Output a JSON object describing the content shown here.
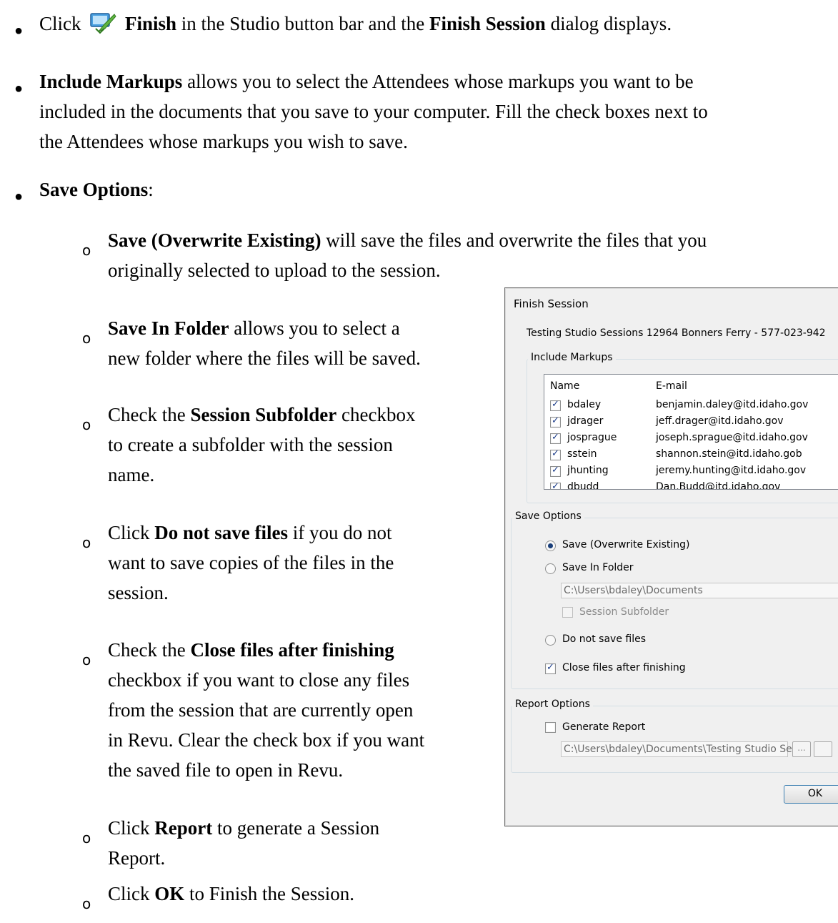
{
  "bullets": {
    "b1": {
      "pre": "Click",
      "strong": "Finish",
      "mid": "in the Studio button bar and the",
      "strong2": "Finish Session",
      "post": "dialog displays."
    },
    "b2": {
      "strong": "Include Markups",
      "line1_rest": "allows you to select the Attendees whose markups you want to be",
      "line2": "included in the documents that you save to your computer. Fill the check boxes next to",
      "line3": "the Attendees whose markups you wish to save."
    },
    "b3": {
      "strong": "Save Options",
      "post": ":"
    }
  },
  "sub_items": {
    "s1": {
      "strong": "Save (Overwrite Existing)",
      "line1_rest": "will save the files and overwrite the files that you",
      "line2": "originally selected to upload to the session."
    },
    "s2": {
      "strong": "Save In Folder",
      "line1_rest": "allows you to select a",
      "line2": "new folder where the files will be saved."
    },
    "s3": {
      "pre": "Check the",
      "strong": "Session Subfolder",
      "line1_rest": "checkbox",
      "line2": "to create a subfolder with the session",
      "line3": "name."
    },
    "s4": {
      "pre": "Click",
      "strong": "Do not save files",
      "line1_rest": "if you do not",
      "line2": "want to save copies of the files in the",
      "line3": "session."
    },
    "s5": {
      "pre": "Check the",
      "strong": "Close files after finishing",
      "line2": "checkbox if you want to close any files",
      "line3": "from the session that are currently open",
      "line4": "in Revu. Clear the check box if you want",
      "line5": "the saved file to open in Revu."
    },
    "s6": {
      "pre": "Click",
      "strong": "Report",
      "line1_rest": "to generate a Session",
      "line2": "Report."
    },
    "s7": {
      "pre": "Click",
      "strong": "OK",
      "line1_rest": "to Finish the Session."
    },
    "marker": "o"
  },
  "dialog": {
    "title": "Finish Session",
    "session_name": "Testing Studio Sessions 12964 Bonners Ferry - 577-023-942",
    "include_markups_label": "Include Markups",
    "col_name": "Name",
    "col_email": "E-mail",
    "attendees": [
      {
        "name": "bdaley",
        "email": "benjamin.daley@itd.idaho.gov",
        "checked": true
      },
      {
        "name": "jdrager",
        "email": "jeff.drager@itd.idaho.gov",
        "checked": true
      },
      {
        "name": "josprague",
        "email": "joseph.sprague@itd.idaho.gov",
        "checked": true
      },
      {
        "name": "sstein",
        "email": "shannon.stein@itd.idaho.gob",
        "checked": true
      },
      {
        "name": "jhunting",
        "email": "jeremy.hunting@itd.idaho.gov",
        "checked": true
      },
      {
        "name": "dbudd",
        "email": "Dan.Budd@itd.idaho.gov",
        "checked": true
      }
    ],
    "save_options_label": "Save Options",
    "opt_overwrite": "Save (Overwrite Existing)",
    "opt_folder": "Save In Folder",
    "folder_path": "C:\\Users\\bdaley\\Documents",
    "session_subfolder": "Session Subfolder",
    "opt_nosave": "Do not save files",
    "close_files": "Close files after finishing",
    "report_options_label": "Report Options",
    "generate_report": "Generate Report",
    "report_path": "C:\\Users\\bdaley\\Documents\\Testing Studio Se",
    "browse_label": "...",
    "ok_label": "OK"
  }
}
